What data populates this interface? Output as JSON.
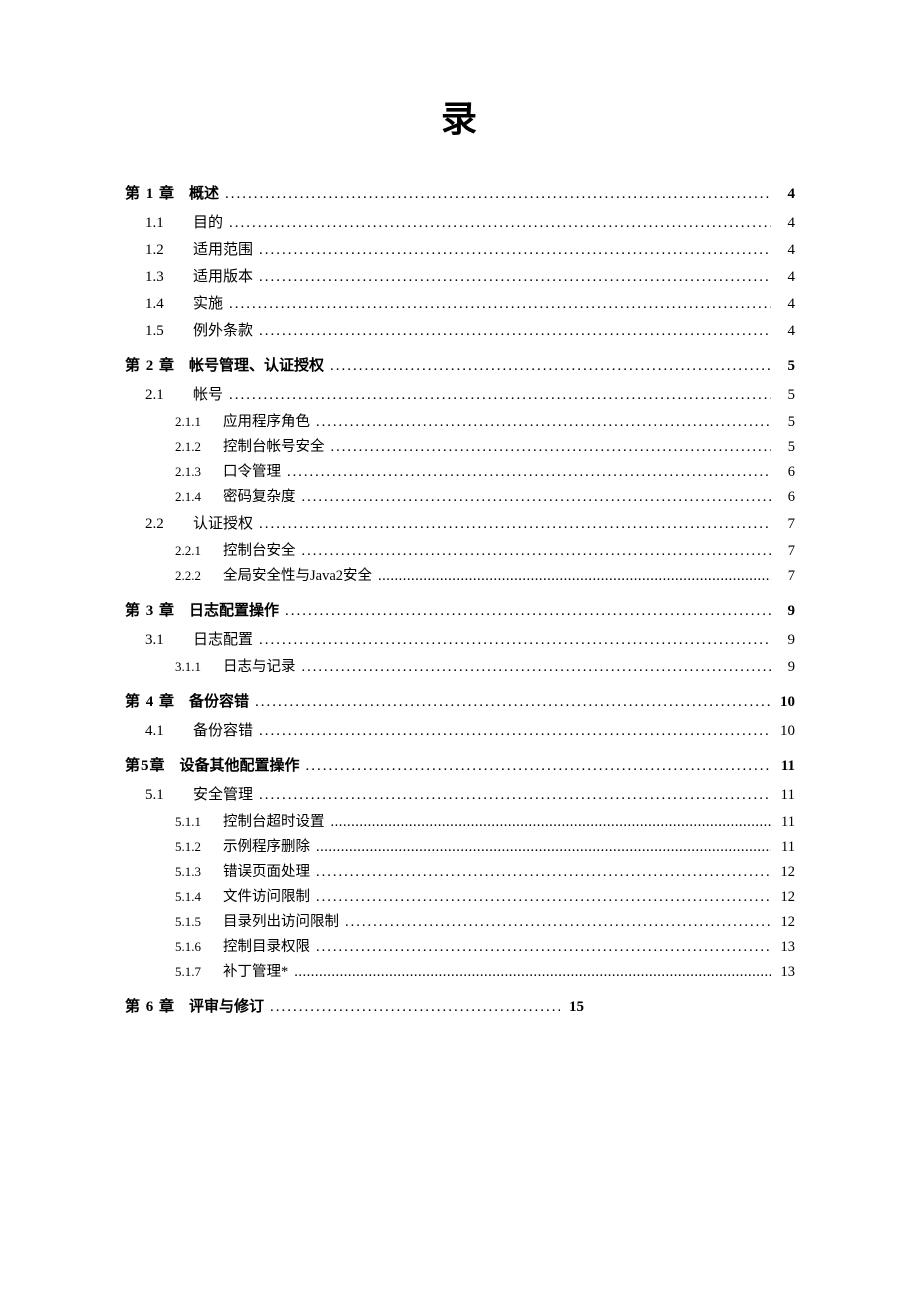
{
  "title": "录",
  "toc": [
    {
      "level": "chapter",
      "num": "第 1 章",
      "title": "概述",
      "page": "4"
    },
    {
      "level": "section",
      "num": "1.1",
      "title": "目的",
      "page": "4"
    },
    {
      "level": "section",
      "num": "1.2",
      "title": "适用范围",
      "page": "4"
    },
    {
      "level": "section",
      "num": "1.3",
      "title": "适用版本",
      "page": "4"
    },
    {
      "level": "section",
      "num": "1.4",
      "title": "实施",
      "page": "4"
    },
    {
      "level": "section",
      "num": "1.5",
      "title": "例外条款",
      "page": "4"
    },
    {
      "level": "chapter",
      "num": "第 2 章",
      "title": "帐号管理、认证授权",
      "page": "5"
    },
    {
      "level": "section",
      "num": "2.1",
      "title": "帐号",
      "page": "5"
    },
    {
      "level": "subsection",
      "num": "2.1.1",
      "title": "应用程序角色",
      "page": "5"
    },
    {
      "level": "subsection",
      "num": "2.1.2",
      "title": "控制台帐号安全",
      "page": "5"
    },
    {
      "level": "subsection",
      "num": "2.1.3",
      "title": "口令管理",
      "page": "6"
    },
    {
      "level": "subsection",
      "num": "2.1.4",
      "title": "密码复杂度",
      "page": "6"
    },
    {
      "level": "section",
      "num": "2.2",
      "title": "认证授权",
      "page": "7"
    },
    {
      "level": "subsection",
      "num": "2.2.1",
      "title": "控制台安全",
      "page": "7"
    },
    {
      "level": "subsection",
      "num": "2.2.2",
      "title": "全局安全性与Java2安全",
      "page": "7",
      "tight": true
    },
    {
      "level": "chapter",
      "num": "第 3 章",
      "title": "日志配置操作",
      "page": "9"
    },
    {
      "level": "section",
      "num": "3.1",
      "title": "日志配置",
      "page": "9"
    },
    {
      "level": "subsection",
      "num": "3.1.1",
      "title": "日志与记录",
      "page": "9"
    },
    {
      "level": "chapter",
      "num": "第 4 章",
      "title": "备份容错",
      "page": "10"
    },
    {
      "level": "section",
      "num": "4.1",
      "title": "备份容错",
      "page": "10"
    },
    {
      "level": "chapter",
      "num": "第5章",
      "title": "设备其他配置操作",
      "page": "11"
    },
    {
      "level": "section",
      "num": "5.1",
      "title": "安全管理",
      "page": "11"
    },
    {
      "level": "subsection",
      "num": "5.1.1",
      "title": "控制台超时设置",
      "page": "11",
      "tight": true
    },
    {
      "level": "subsection",
      "num": "5.1.2",
      "title": "示例程序删除",
      "page": "11",
      "tight": true
    },
    {
      "level": "subsection",
      "num": "5.1.3",
      "title": "错误页面处理",
      "page": "12"
    },
    {
      "level": "subsection",
      "num": "5.1.4",
      "title": "文件访问限制",
      "page": "12"
    },
    {
      "level": "subsection",
      "num": "5.1.5",
      "title": "目录列出访问限制",
      "page": "12"
    },
    {
      "level": "subsection",
      "num": "5.1.6",
      "title": "控制目录权限",
      "page": "13"
    },
    {
      "level": "subsection",
      "num": "5.1.7",
      "title": "补丁管理*",
      "page": "13",
      "tight": true
    },
    {
      "level": "chapter",
      "num": "第 6 章",
      "title": "评审与修订",
      "page": "15",
      "short": true
    }
  ]
}
